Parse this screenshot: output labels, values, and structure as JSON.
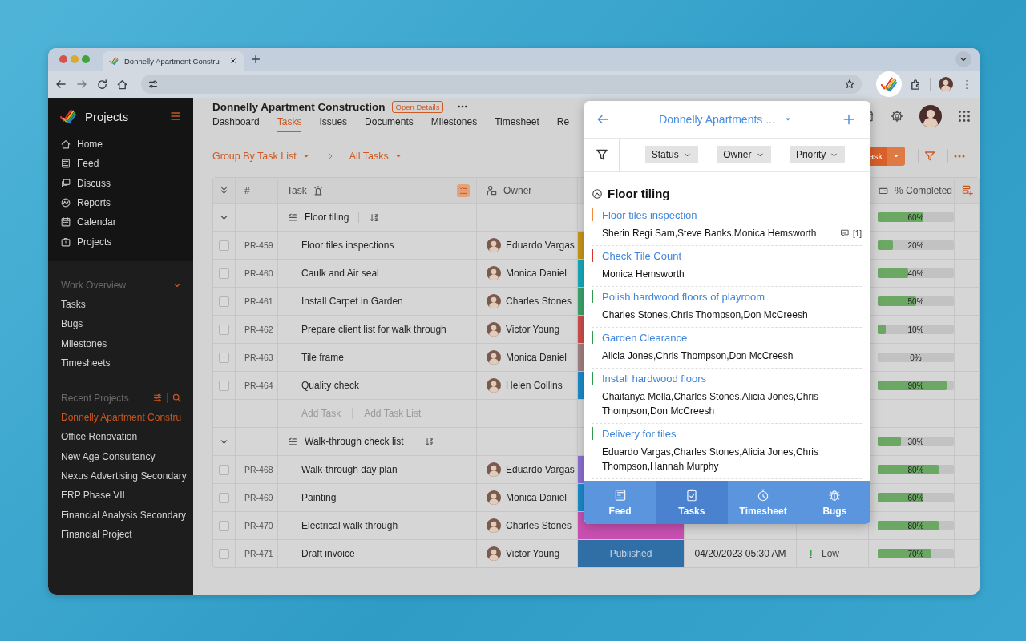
{
  "browser": {
    "tab_title": "Donnelly Apartment Constru"
  },
  "sidebar": {
    "title": "Projects",
    "nav": [
      {
        "label": "Home",
        "kind": "home"
      },
      {
        "label": "Feed",
        "kind": "feed"
      },
      {
        "label": "Discuss",
        "kind": "discuss"
      },
      {
        "label": "Reports",
        "kind": "reports"
      },
      {
        "label": "Calendar",
        "kind": "calendar"
      },
      {
        "label": "Projects",
        "kind": "projects"
      }
    ],
    "work_overview": {
      "title": "Work Overview",
      "expanded": true,
      "items": [
        "Tasks",
        "Bugs",
        "Milestones",
        "Timesheets"
      ]
    },
    "recent_projects": {
      "title": "Recent Projects",
      "items": [
        {
          "label": "Donnelly Apartment Constru",
          "selected": true
        },
        {
          "label": "Office Renovation",
          "selected": false
        },
        {
          "label": "New Age Consultancy",
          "selected": false
        },
        {
          "label": "Nexus Advertising Secondary",
          "selected": false
        },
        {
          "label": "ERP Phase VII",
          "selected": false
        },
        {
          "label": "Financial Analysis Secondary",
          "selected": false
        },
        {
          "label": "Financial  Project",
          "selected": false
        }
      ]
    }
  },
  "project": {
    "title": "Donnelly Apartment Construction",
    "details_button": "Open Details",
    "tabs": [
      {
        "label": "Dashboard",
        "selected": false
      },
      {
        "label": "Tasks",
        "selected": true
      },
      {
        "label": "Issues",
        "selected": false
      },
      {
        "label": "Documents",
        "selected": false
      },
      {
        "label": "Milestones",
        "selected": false
      },
      {
        "label": "Timesheet",
        "selected": false
      },
      {
        "label": "Re",
        "selected": false
      }
    ]
  },
  "toolbar": {
    "group_by": "Group By Task List",
    "view": "All Tasks",
    "add_button": "ask"
  },
  "table": {
    "columns": [
      "#",
      "Task",
      "Owner",
      "% Completed"
    ],
    "groups": [
      {
        "name": "Floor tiling",
        "expanded": true,
        "level": 0.6,
        "percent": "60%",
        "add_task": "Add Task",
        "add_task_list": "Add Task List",
        "rows": [
          {
            "id": "PR-459",
            "task": "Floor tiles inspections",
            "owner": "Eduardo Vargas",
            "checked": false,
            "color": "#c8951a",
            "level": 0.2,
            "percent": "20%"
          },
          {
            "id": "PR-460",
            "task": "Caulk and Air seal",
            "owner": "Monica Daniel",
            "checked": false,
            "color": "#16a9b8",
            "level": 0.4,
            "percent": "40%"
          },
          {
            "id": "PR-461",
            "task": "Install Carpet in Garden",
            "owner": "Charles Stones",
            "checked": false,
            "color": "#3aa36a",
            "level": 0.5,
            "percent": "50%"
          },
          {
            "id": "PR-462",
            "task": "Prepare client list for walk through",
            "owner": "Victor Young",
            "checked": false,
            "color": "#cc4c4c",
            "level": 0.1,
            "percent": "10%"
          },
          {
            "id": "PR-463",
            "task": "Tile frame",
            "owner": "Monica Daniel",
            "checked": false,
            "color": "#a08080",
            "level": 0,
            "percent": "0%"
          },
          {
            "id": "PR-464",
            "task": "Quality check",
            "owner": "Helen Collins",
            "checked": false,
            "color": "#1a8ac8",
            "level": 0.9,
            "percent": "90%"
          }
        ]
      },
      {
        "name": "Walk-through check list",
        "expanded": true,
        "level": 0.3,
        "percent": "30%",
        "rows": [
          {
            "id": "PR-468",
            "task": "Walk-through day plan",
            "owner": "Eduardo Vargas",
            "checked": false,
            "color": "#8a70d0",
            "level": 0.8,
            "percent": "80%"
          },
          {
            "id": "PR-469",
            "task": "Painting",
            "owner": "Monica Daniel",
            "checked": false,
            "color": "#1a8ac8",
            "level": 0.6,
            "percent": "60%"
          },
          {
            "id": "PR-470",
            "task": "Electrical walk through",
            "owner": "Charles Stones",
            "checked": false,
            "color": "#c850b0",
            "level": 0.8,
            "percent": "80%"
          },
          {
            "id": "PR-471",
            "task": "Draft invoice",
            "owner": "Victor Young",
            "checked": false,
            "color": "#2f6fa6",
            "status": "Published",
            "due_date": "04/20/2023 05:30 AM",
            "priority": "Low",
            "level": 0.7,
            "percent": "70%"
          }
        ]
      }
    ]
  },
  "popup": {
    "title": "Donnelly Apartments ...",
    "filters": [
      "Status",
      "Owner",
      "Priority"
    ],
    "group": {
      "name": "Floor tiling",
      "expanded": true
    },
    "tasks": [
      {
        "title": "Floor tiles inspection",
        "color": "#f08a3c",
        "owners": "Sherin Regi Sam,Steve Banks,Monica Hemsworth",
        "comments": "[1]"
      },
      {
        "title": "Check Tile Count",
        "color": "#d9342b",
        "owners": "Monica Hemsworth"
      },
      {
        "title": "Polish hardwood floors of playroom",
        "color": "#2e9b4f",
        "owners": "Charles Stones,Chris Thompson,Don McCreesh"
      },
      {
        "title": "Garden Clearance",
        "color": "#2e9b4f",
        "owners": "Alicia Jones,Chris Thompson,Don McCreesh"
      },
      {
        "title": "Install hardwood floors",
        "color": "#2e9b4f",
        "owners": "Chaitanya Mella,Charles Stones,Alicia Jones,Chris Thompson,Don McCreesh"
      },
      {
        "title": "Delivery for tiles",
        "color": "#2e9b4f",
        "owners": "Eduardo Vargas,Charles Stones,Alicia Jones,Chris Thompson,Hannah Murphy"
      }
    ],
    "nav": [
      {
        "label": "Feed",
        "kind": "feed",
        "selected": false
      },
      {
        "label": "Tasks",
        "kind": "tasks",
        "selected": true
      },
      {
        "label": "Timesheet",
        "kind": "timesheet",
        "selected": false
      },
      {
        "label": "Bugs",
        "kind": "bugs",
        "selected": false
      }
    ]
  }
}
